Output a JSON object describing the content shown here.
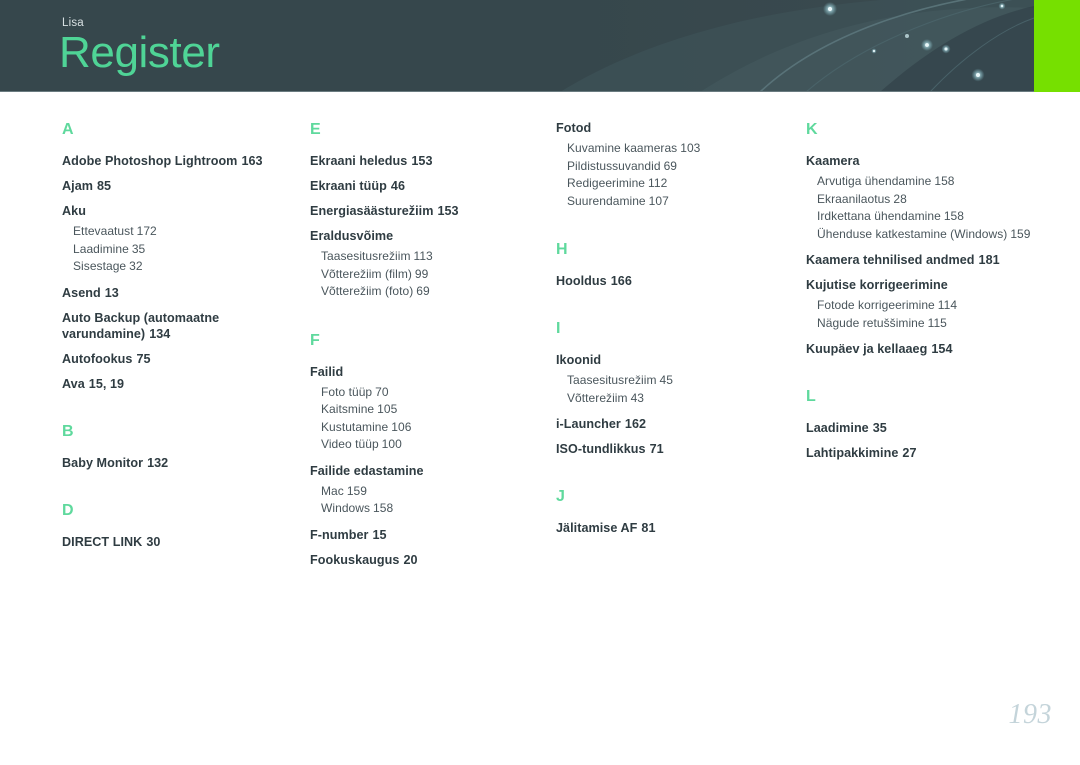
{
  "header": {
    "kicker": "Lisa",
    "title": "Register",
    "accent_green": "#76e000",
    "title_color": "#4fd496",
    "background_color": "#36474c"
  },
  "page_number": "193",
  "index": {
    "columns": [
      {
        "id": "column-1",
        "groups": [
          {
            "letter": "A",
            "entries": [
              {
                "term": "Adobe Photoshop Lightroom",
                "page": "163",
                "sub": []
              },
              {
                "term": "Ajam",
                "page": "85",
                "sub": []
              },
              {
                "term": "Aku",
                "page": "",
                "sub": [
                  {
                    "term": "Ettevaatust",
                    "page": "172"
                  },
                  {
                    "term": "Laadimine",
                    "page": "35"
                  },
                  {
                    "term": "Sisestage",
                    "page": "32"
                  }
                ]
              },
              {
                "term": "Asend",
                "page": "13",
                "sub": []
              },
              {
                "term": "Auto Backup (automaatne varundamine)",
                "page": "134",
                "sub": []
              },
              {
                "term": "Autofookus",
                "page": "75",
                "sub": []
              },
              {
                "term": "Ava",
                "page": "15, 19",
                "sub": []
              }
            ]
          },
          {
            "letter": "B",
            "entries": [
              {
                "term": "Baby Monitor",
                "page": "132",
                "sub": []
              }
            ]
          },
          {
            "letter": "D",
            "entries": [
              {
                "term": "DIRECT LINK",
                "page": "30",
                "sub": []
              }
            ]
          }
        ]
      },
      {
        "id": "column-2",
        "groups": [
          {
            "letter": "E",
            "entries": [
              {
                "term": "Ekraani heledus",
                "page": "153",
                "sub": []
              },
              {
                "term": "Ekraani tüüp",
                "page": "46",
                "sub": []
              },
              {
                "term": "Energiasäästurežiim",
                "page": "153",
                "sub": []
              },
              {
                "term": "Eraldusvõime",
                "page": "",
                "sub": [
                  {
                    "term": "Taasesitusrežiim",
                    "page": "113"
                  },
                  {
                    "term": "Võtterežiim (film)",
                    "page": "99"
                  },
                  {
                    "term": "Võtterežiim (foto)",
                    "page": "69"
                  }
                ]
              }
            ]
          },
          {
            "letter": "F",
            "entries": [
              {
                "term": "Failid",
                "page": "",
                "sub": [
                  {
                    "term": "Foto tüüp",
                    "page": "70"
                  },
                  {
                    "term": "Kaitsmine",
                    "page": "105"
                  },
                  {
                    "term": "Kustutamine",
                    "page": "106"
                  },
                  {
                    "term": "Video tüüp",
                    "page": "100"
                  }
                ]
              },
              {
                "term": "Failide edastamine",
                "page": "",
                "sub": [
                  {
                    "term": "Mac",
                    "page": "159"
                  },
                  {
                    "term": "Windows",
                    "page": "158"
                  }
                ]
              },
              {
                "term": "F-number",
                "page": "15",
                "sub": []
              },
              {
                "term": "Fookuskaugus",
                "page": "20",
                "sub": []
              }
            ]
          }
        ]
      },
      {
        "id": "column-3",
        "groups": [
          {
            "letter": "",
            "entries": [
              {
                "term": "Fotod",
                "page": "",
                "sub": [
                  {
                    "term": "Kuvamine kaameras",
                    "page": "103"
                  },
                  {
                    "term": "Pildistussuvandid",
                    "page": "69"
                  },
                  {
                    "term": "Redigeerimine",
                    "page": "112"
                  },
                  {
                    "term": "Suurendamine",
                    "page": "107"
                  }
                ]
              }
            ]
          },
          {
            "letter": "H",
            "entries": [
              {
                "term": "Hooldus",
                "page": "166",
                "sub": []
              }
            ]
          },
          {
            "letter": "I",
            "entries": [
              {
                "term": "Ikoonid",
                "page": "",
                "sub": [
                  {
                    "term": "Taasesitusrežiim",
                    "page": "45"
                  },
                  {
                    "term": "Võtterežiim",
                    "page": "43"
                  }
                ]
              },
              {
                "term": "i-Launcher",
                "page": "162",
                "sub": []
              },
              {
                "term": "ISO-tundlikkus",
                "page": "71",
                "sub": []
              }
            ]
          },
          {
            "letter": "J",
            "entries": [
              {
                "term": "Jälitamise AF",
                "page": "81",
                "sub": []
              }
            ]
          }
        ]
      },
      {
        "id": "column-4",
        "groups": [
          {
            "letter": "K",
            "entries": [
              {
                "term": "Kaamera",
                "page": "",
                "sub": [
                  {
                    "term": "Arvutiga ühendamine",
                    "page": "158"
                  },
                  {
                    "term": "Ekraanilaotus",
                    "page": "28"
                  },
                  {
                    "term": "Irdkettana ühendamine",
                    "page": "158"
                  },
                  {
                    "term": "Ühenduse katkestamine (Windows)",
                    "page": "159"
                  }
                ]
              },
              {
                "term": "Kaamera tehnilised andmed",
                "page": "181",
                "sub": []
              },
              {
                "term": "Kujutise korrigeerimine",
                "page": "",
                "sub": [
                  {
                    "term": "Fotode korrigeerimine",
                    "page": "114"
                  },
                  {
                    "term": "Nägude retuššimine",
                    "page": "115"
                  }
                ]
              },
              {
                "term": "Kuupäev ja kellaaeg",
                "page": "154",
                "sub": []
              }
            ]
          },
          {
            "letter": "L",
            "entries": [
              {
                "term": "Laadimine",
                "page": "35",
                "sub": []
              },
              {
                "term": "Lahtipakkimine",
                "page": "27",
                "sub": []
              }
            ]
          }
        ]
      }
    ]
  }
}
